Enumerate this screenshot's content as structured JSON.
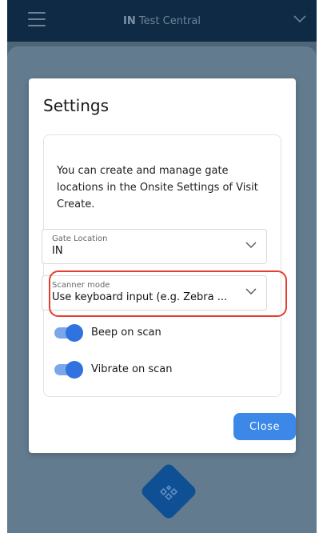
{
  "topbar": {
    "title_prefix": "IN",
    "title_rest": " Test Central"
  },
  "modal": {
    "title": "Settings",
    "info": "You can create and manage gate locations in the Onsite Settings of Visit Create.",
    "gate": {
      "label": "Gate Location",
      "value": "IN"
    },
    "scanner": {
      "label": "Scanner mode",
      "value": "Use keyboard input (e.g. Zebra ..."
    },
    "beep": {
      "label": "Beep on scan",
      "on": true
    },
    "vibrate": {
      "label": "Vibrate on scan",
      "on": true
    },
    "close_label": "Close"
  },
  "colors": {
    "accent": "#3b88e8",
    "topbar": "#0e2a45",
    "highlight": "#e53d2e"
  }
}
